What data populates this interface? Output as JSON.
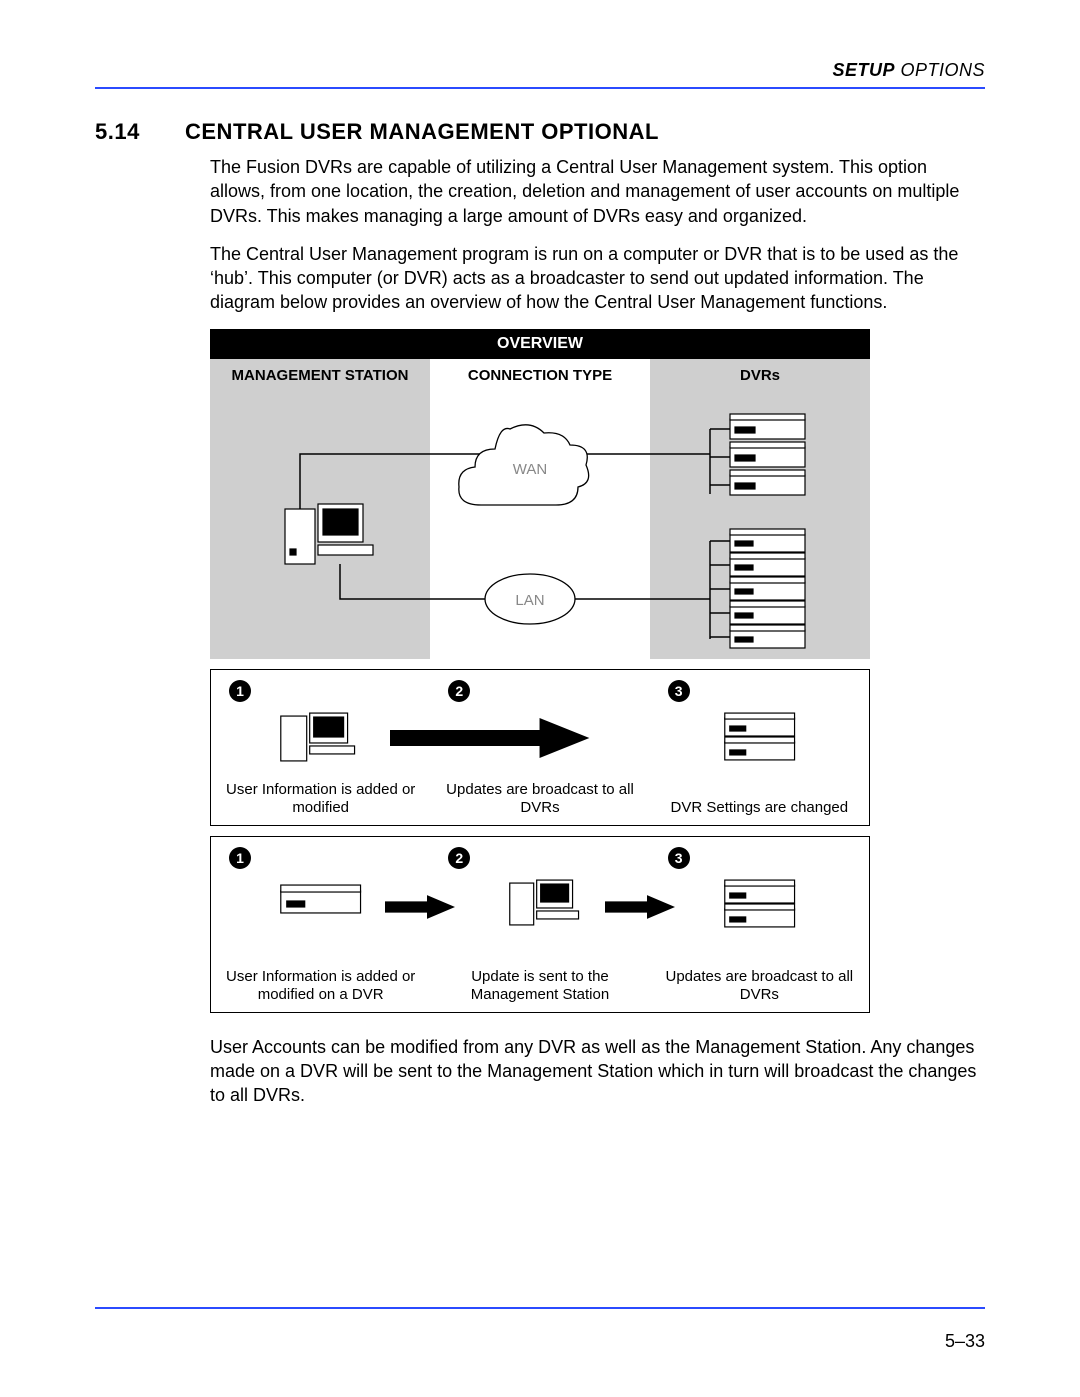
{
  "running_head": {
    "bold": "SETUP",
    "rest": " OPTIONS"
  },
  "section": {
    "number": "5.14",
    "title": "CENTRAL USER MANAGEMENT OPTIONAL"
  },
  "para1": "The Fusion DVRs are capable of utilizing a Central User Management system. This option allows, from one location, the creation, deletion and management of  user accounts on multiple DVRs. This makes managing a large amount of DVRs easy and organized.",
  "para2": "The Central User Management program is run on a computer or DVR that is to be used as the ‘hub’. This computer (or DVR) acts as a broadcaster to send out updated information. The diagram below provides an overview of how the Central User Management functions.",
  "overview": {
    "title": "OVERVIEW",
    "col1": "MANAGEMENT STATION",
    "col2": "CONNECTION TYPE",
    "col3": "DVRs",
    "wan": "WAN",
    "lan": "LAN"
  },
  "flow_a": {
    "n1": "1",
    "n2": "2",
    "n3": "3",
    "c1": "User Information is added or modified",
    "c2": "Updates are broadcast to all DVRs",
    "c3": "DVR Settings are changed"
  },
  "flow_b": {
    "n1": "1",
    "n2": "2",
    "n3": "3",
    "c1": "User Information is added or modified on a DVR",
    "c2": "Update is sent to the Management Station",
    "c3": "Updates are broadcast to all DVRs"
  },
  "para3": "User Accounts can be modified from any DVR as well as the Management Station. Any changes made on a DVR will be sent to the Management Station which in turn will broadcast the changes to all DVRs.",
  "page_number": "5–33"
}
